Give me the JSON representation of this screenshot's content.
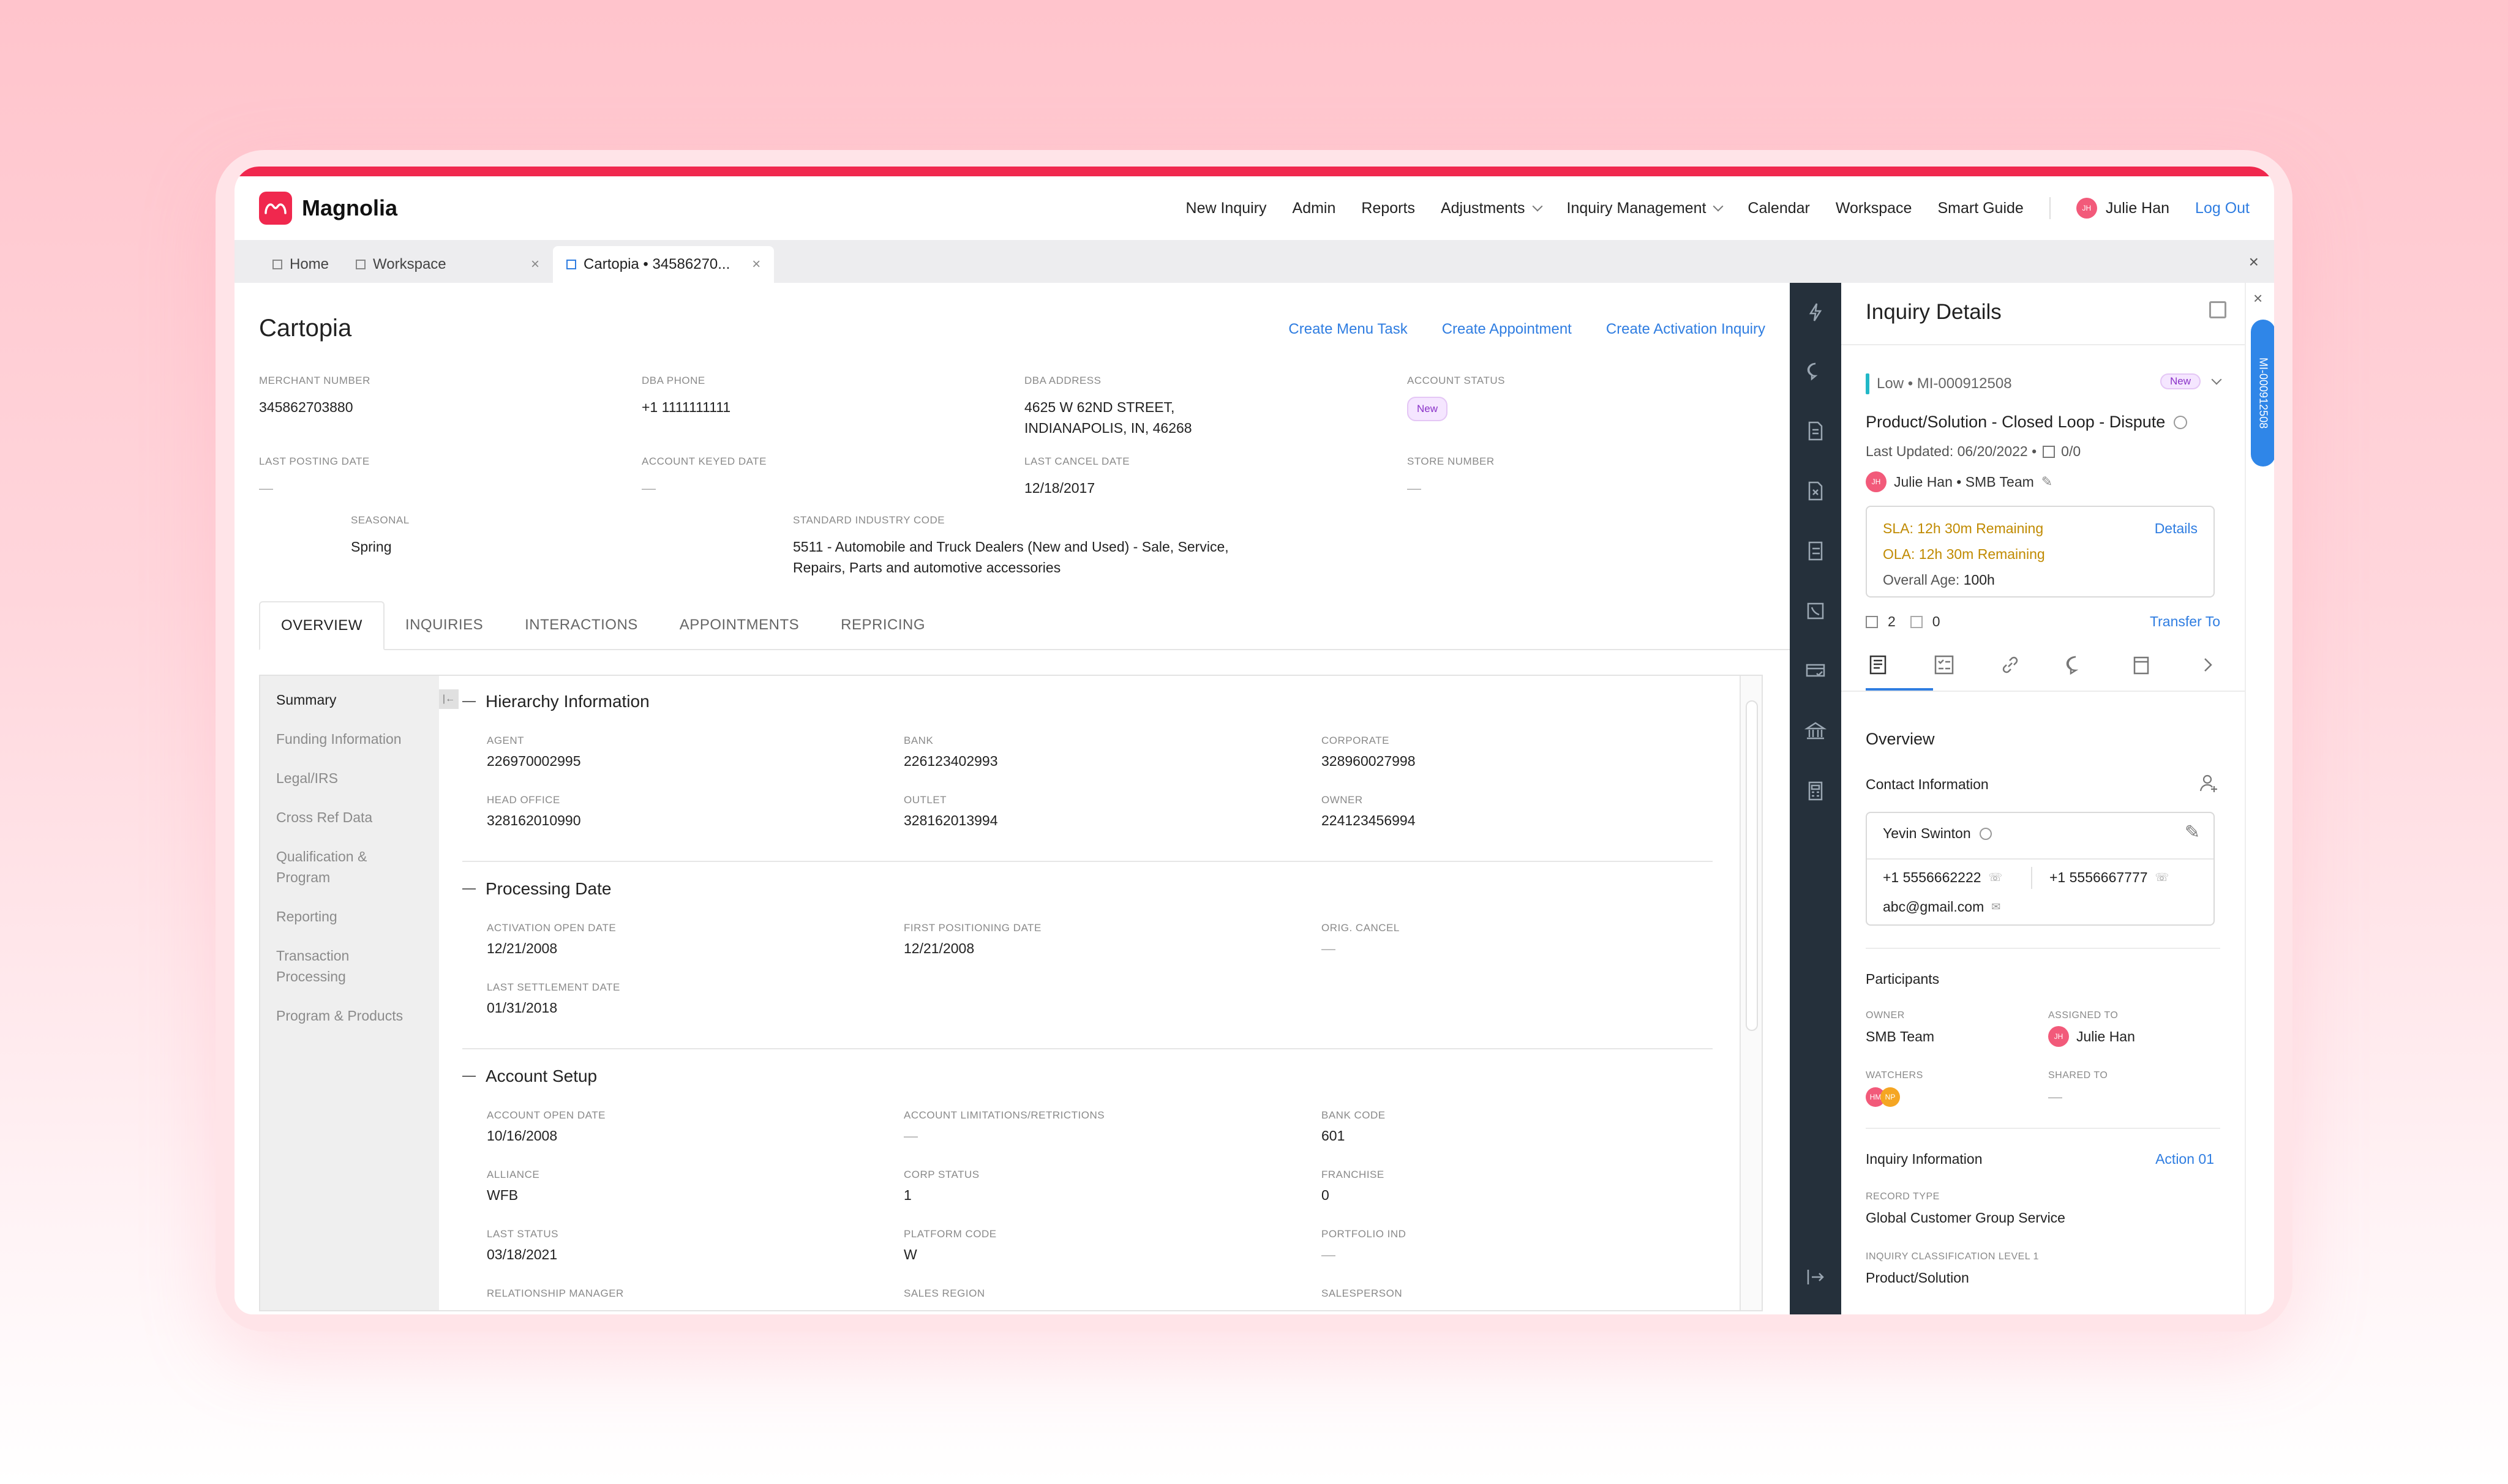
{
  "app": {
    "name": "Magnolia"
  },
  "nav": {
    "items": [
      "New Inquiry",
      "Admin",
      "Reports",
      "Adjustments",
      "Inquiry Management",
      "Calendar",
      "Workspace",
      "Smart Guide"
    ],
    "user_initials": "JH",
    "user_name": "Julie Han",
    "logout": "Log Out"
  },
  "tabs": [
    {
      "label": "Home"
    },
    {
      "label": "Workspace"
    },
    {
      "label": "Cartopia • 34586270..."
    }
  ],
  "merchant": {
    "name": "Cartopia",
    "actions": [
      "Create Menu Task",
      "Create Appointment",
      "Create Activation Inquiry"
    ],
    "fields": {
      "merchant_number": {
        "label": "MERCHANT NUMBER",
        "value": "345862703880"
      },
      "dba_phone": {
        "label": "DBA PHONE",
        "value": "+1 1111111111"
      },
      "dba_address": {
        "label": "DBA ADDRESS",
        "line1": "4625 W 62ND STREET,",
        "line2": "INDIANAPOLIS, IN, 46268"
      },
      "account_status": {
        "label": "ACCOUNT STATUS",
        "value": "New"
      },
      "last_posting_date": {
        "label": "LAST POSTING DATE",
        "value": "—"
      },
      "account_keyed_date": {
        "label": "ACCOUNT KEYED DATE",
        "value": "—"
      },
      "last_cancel_date": {
        "label": "LAST CANCEL DATE",
        "value": "12/18/2017"
      },
      "store_number": {
        "label": "STORE NUMBER",
        "value": "—"
      },
      "seasonal": {
        "label": "SEASONAL",
        "value": "Spring"
      },
      "sic": {
        "label": "STANDARD INDUSTRY CODE",
        "line1": "5511 - Automobile and Truck Dealers (New and Used) - Sale, Service,",
        "line2": "Repairs, Parts and automotive accessories"
      }
    }
  },
  "page_tabs": [
    "OVERVIEW",
    "INQUIRIES",
    "INTERACTIONS",
    "APPOINTMENTS",
    "REPRICING"
  ],
  "side_nav": [
    "Summary",
    "Funding Information",
    "Legal/IRS",
    "Cross Ref Data",
    "Qualification & Program",
    "Reporting",
    "Transaction Processing",
    "Program & Products"
  ],
  "sections": {
    "hierarchy": {
      "title": "Hierarchy Information",
      "agent": {
        "label": "AGENT",
        "value": "226970002995"
      },
      "bank": {
        "label": "BANK",
        "value": "226123402993"
      },
      "corporate": {
        "label": "CORPORATE",
        "value": "328960027998"
      },
      "head_office": {
        "label": "HEAD OFFICE",
        "value": "328162010990"
      },
      "outlet": {
        "label": "OUTLET",
        "value": "328162013994"
      },
      "owner": {
        "label": "OWNER",
        "value": "224123456994"
      }
    },
    "processing": {
      "title": "Processing Date",
      "activation_open": {
        "label": "ACTIVATION OPEN DATE",
        "value": "12/21/2008"
      },
      "first_positioning": {
        "label": "FIRST POSITIONING DATE",
        "value": "12/21/2008"
      },
      "orig_cancel": {
        "label": "ORIG. CANCEL",
        "value": "—"
      },
      "last_settlement": {
        "label": "LAST SETTLEMENT DATE",
        "value": "01/31/2018"
      }
    },
    "account": {
      "title": "Account Setup",
      "account_open": {
        "label": "ACCOUNT OPEN DATE",
        "value": "10/16/2008"
      },
      "limitations": {
        "label": "ACCOUNT LIMITATIONS/RETRICTIONS",
        "value": "—"
      },
      "bank_code": {
        "label": "BANK CODE",
        "value": "601"
      },
      "alliance": {
        "label": "ALLIANCE",
        "value": "WFB"
      },
      "corp_status": {
        "label": "CORP STATUS",
        "value": "1"
      },
      "franchise": {
        "label": "FRANCHISE",
        "value": "0"
      },
      "last_status": {
        "label": "LAST STATUS",
        "value": "03/18/2021"
      },
      "platform_code": {
        "label": "PLATFORM CODE",
        "value": "W"
      },
      "portfolio_ind": {
        "label": "PORTFOLIO IND",
        "value": "—"
      },
      "relationship_manager": {
        "label": "RELATIONSHIP MANAGER"
      },
      "sales_region": {
        "label": "SALES REGION"
      },
      "salesperson": {
        "label": "SALESPERSON"
      }
    }
  },
  "inquiry": {
    "title": "Inquiry Details",
    "priority": "Low • MI-000912508",
    "status": "New",
    "subject": "Product/Solution - Closed Loop - Dispute",
    "last_updated": "Last Updated: 06/20/2022 •",
    "counter": "0/0",
    "assignee_initials": "JH",
    "assignee": "Julie Han • SMB Team",
    "sla_label": "SLA:",
    "sla_value": "12h 30m Remaining",
    "ola_label": "OLA:",
    "ola_value": "12h 30m Remaining",
    "age_label": "Overall Age:",
    "age_value": "100h",
    "details_link": "Details",
    "count_a": "2",
    "count_b": "0",
    "transfer": "Transfer To",
    "overview": "Overview",
    "contact_title": "Contact Information",
    "contact_name": "Yevin Swinton",
    "phone1": "+1 5556662222",
    "phone2": "+1 5556667777",
    "email": "abc@gmail.com",
    "participants": "Participants",
    "owner_label": "OWNER",
    "owner": "SMB Team",
    "assigned_label": "ASSIGNED TO",
    "assigned": "Julie Han",
    "watchers_label": "WATCHERS",
    "watcher1": "HM",
    "watcher2": "NP",
    "shared_label": "SHARED TO",
    "shared": "—",
    "inquiry_info": "Inquiry Information",
    "action": "Action 01",
    "record_type_label": "RECORD TYPE",
    "record_type": "Global Customer Group Service",
    "class_label": "INQUIRY CLASSIFICATION LEVEL 1",
    "class_value": "Product/Solution",
    "side_pill": "MI-000912508"
  },
  "colors": {
    "brand": "#f0284e",
    "link": "#2f7de1",
    "rail": "#25303b",
    "sla": "#c08a00"
  }
}
